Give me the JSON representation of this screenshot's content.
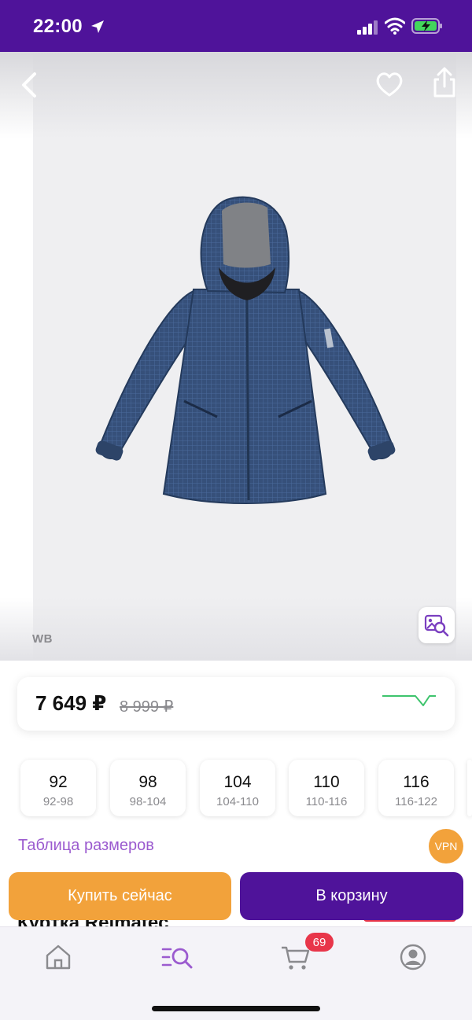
{
  "status_bar": {
    "time": "22:00",
    "colors": {
      "background": "#4f139a"
    }
  },
  "gallery": {
    "watermark": "WB",
    "icons": [
      "back-chevron-icon",
      "heart-icon",
      "share-icon",
      "visual-search-icon"
    ]
  },
  "price": {
    "current": "7 649 ₽",
    "old": "8 999 ₽"
  },
  "sizes": [
    {
      "size": "92",
      "range": "92-98"
    },
    {
      "size": "98",
      "range": "98-104"
    },
    {
      "size": "104",
      "range": "104-110"
    },
    {
      "size": "110",
      "range": "110-116"
    },
    {
      "size": "116",
      "range": "116-122"
    }
  ],
  "size_table_link": "Таблица размеров",
  "vpn_badge": "VPN",
  "product_title_peek": "Куртка Reimatec",
  "actions": {
    "buy_now": "Купить сейчас",
    "add_to_cart": "В корзину"
  },
  "tab_bar": {
    "items": [
      "home-icon",
      "catalog-search-icon",
      "cart-icon",
      "profile-icon"
    ],
    "cart_count": "69"
  },
  "colors": {
    "brand": "#4f139a",
    "accent_orange": "#f2a23b",
    "link_purple": "#9b5bcf",
    "badge_red": "#e8364a"
  }
}
